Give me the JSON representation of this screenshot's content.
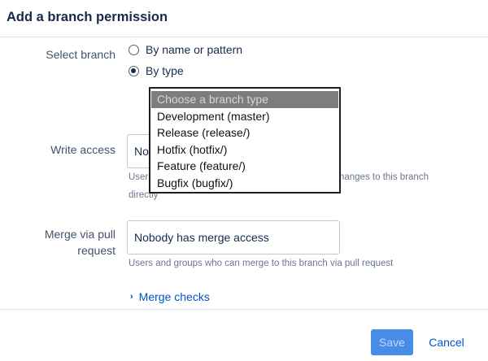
{
  "dialog": {
    "title": "Add a branch permission"
  },
  "select_branch": {
    "label": "Select branch",
    "options": [
      {
        "label": "By name or pattern",
        "checked": false
      },
      {
        "label": "By type",
        "checked": true
      }
    ]
  },
  "branch_type_dropdown": {
    "placeholder": "Choose a branch type",
    "options": [
      "Development (master)",
      "Release (release/)",
      "Hotfix (hotfix/)",
      "Feature (feature/)",
      "Bugfix (bugfix/)"
    ]
  },
  "write_access": {
    "label": "Write access",
    "value": "No",
    "help_start": "User",
    "help_end": "hanges to this branch",
    "help_line2": "directly"
  },
  "merge_via_pull_request": {
    "label_line1": "Merge via pull",
    "label_line2": "request",
    "value": "Nobody has merge access",
    "help": "Users and groups who can merge to this branch via pull request"
  },
  "merge_checks": {
    "label": "Merge checks"
  },
  "footer": {
    "save_label": "Save",
    "cancel_label": "Cancel"
  }
}
